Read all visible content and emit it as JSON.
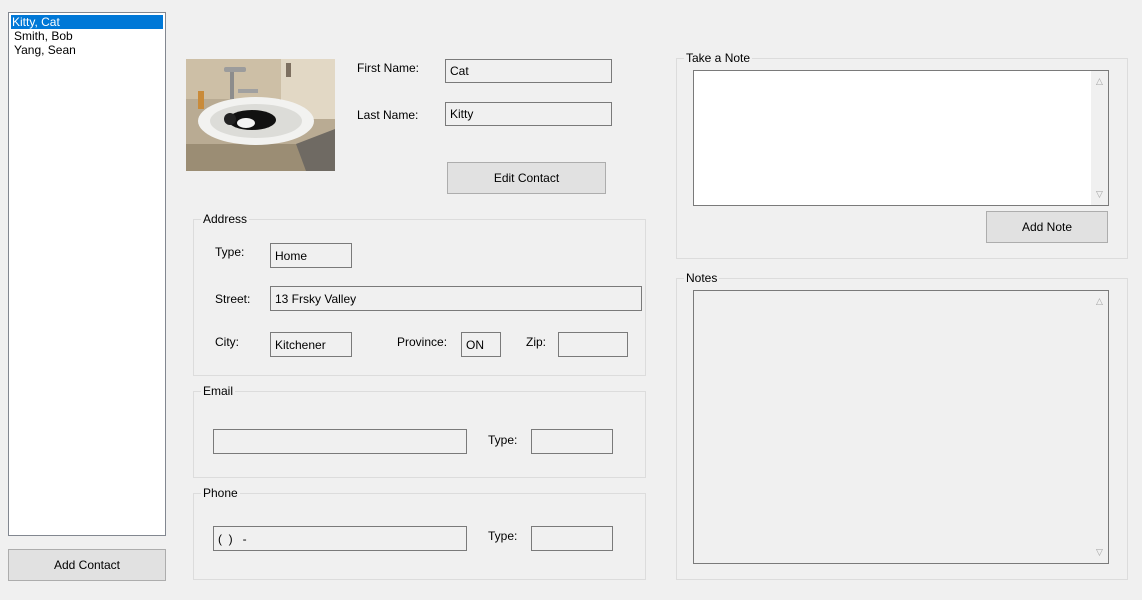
{
  "contacts": {
    "items": [
      "Kitty, Cat",
      "Smith, Bob",
      "Yang, Sean"
    ],
    "selected_index": 0,
    "add_button": "Add Contact"
  },
  "contact": {
    "first_name_label": "First Name:",
    "first_name": "Cat",
    "last_name_label": "Last Name:",
    "last_name": "Kitty",
    "edit_button": "Edit Contact"
  },
  "address": {
    "title": "Address",
    "type_label": "Type:",
    "type": "Home",
    "street_label": "Street:",
    "street": "13 Frsky Valley",
    "city_label": "City:",
    "city": "Kitchener",
    "province_label": "Province:",
    "province": "ON",
    "zip_label": "Zip:",
    "zip": ""
  },
  "email": {
    "title": "Email",
    "value": "",
    "type_label": "Type:",
    "type": ""
  },
  "phone": {
    "title": "Phone",
    "value": "(  )   -",
    "type_label": "Type:",
    "type": ""
  },
  "take_note": {
    "title": "Take a Note",
    "value": "",
    "add_button": "Add Note"
  },
  "notes": {
    "title": "Notes",
    "value": ""
  },
  "colors": {
    "selection": "#0078d7",
    "window_bg": "#f0f0f0"
  }
}
